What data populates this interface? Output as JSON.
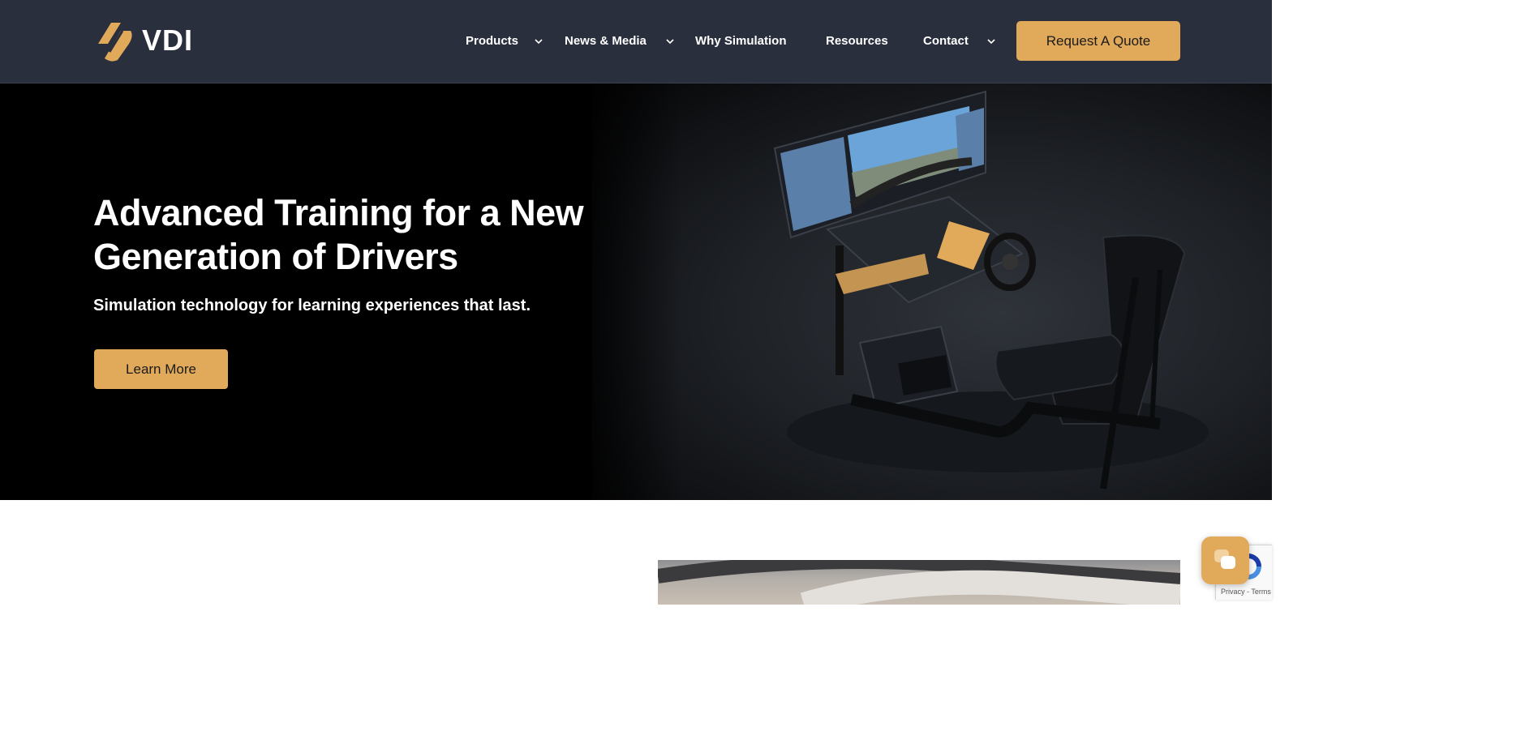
{
  "brand": {
    "name": "VDI",
    "accent_color": "#e1a95a",
    "header_bg": "#2a2f3d"
  },
  "nav": {
    "items": [
      {
        "label": "Products",
        "has_dropdown": true
      },
      {
        "label": "News & Media",
        "has_dropdown": true
      },
      {
        "label": "Why Simulation",
        "has_dropdown": false
      },
      {
        "label": "Resources",
        "has_dropdown": false
      },
      {
        "label": "Contact",
        "has_dropdown": true
      }
    ],
    "cta_label": "Request A Quote"
  },
  "hero": {
    "title": "Advanced Training for a New Generation of Drivers",
    "subtitle": "Simulation technology for learning experiences that last.",
    "button_label": "Learn More"
  },
  "widgets": {
    "chat_icon": "chat-bubbles-icon",
    "recaptcha_text": "Privacy - Terms"
  }
}
